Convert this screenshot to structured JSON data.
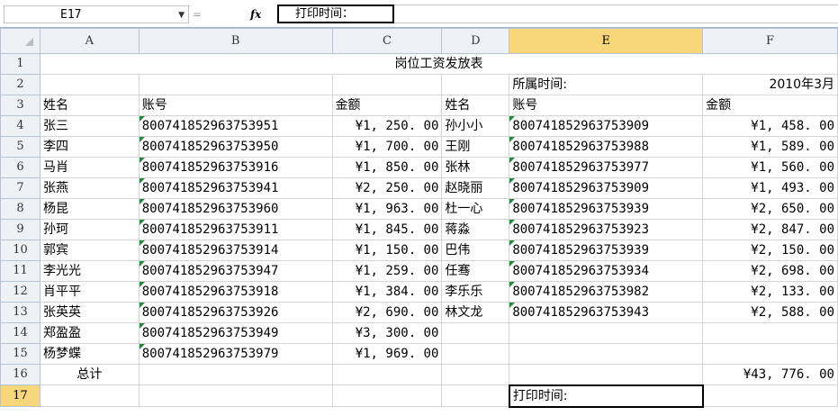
{
  "formula_bar": {
    "name_box": "E17",
    "formula_content": "打印时间：",
    "fx_label": "fx",
    "cancel_symbol": "=",
    "dropdown_symbol": "▼"
  },
  "columns": [
    "A",
    "B",
    "C",
    "D",
    "E",
    "F"
  ],
  "selected_column": "E",
  "row_numbers": [
    "1",
    "2",
    "3",
    "4",
    "5",
    "6",
    "7",
    "8",
    "9",
    "10",
    "11",
    "12",
    "13",
    "14",
    "15",
    "16",
    "17"
  ],
  "selected_row": "17",
  "title": "岗位工资发放表",
  "period_label": "所属时间:",
  "period_value": "2010年3月",
  "headers": {
    "name_1": "姓名",
    "account_1": "账号",
    "amount_1": "金额",
    "name_2": "姓名",
    "account_2": "账号",
    "amount_2": "金额"
  },
  "rows": [
    {
      "n1": "张三",
      "a1": "800741852963753951",
      "m1": "¥1, 250. 00",
      "n2": "孙小小",
      "a2": "800741852963753909",
      "m2": "¥1, 458. 00"
    },
    {
      "n1": "李四",
      "a1": "800741852963753950",
      "m1": "¥1, 700. 00",
      "n2": "王刚",
      "a2": "800741852963753988",
      "m2": "¥1, 589. 00"
    },
    {
      "n1": "马肖",
      "a1": "800741852963753916",
      "m1": "¥1, 850. 00",
      "n2": "张林",
      "a2": "800741852963753977",
      "m2": "¥1, 560. 00"
    },
    {
      "n1": "张燕",
      "a1": "800741852963753941",
      "m1": "¥2, 250. 00",
      "n2": "赵晓丽",
      "a2": "800741852963753909",
      "m2": "¥1, 493. 00"
    },
    {
      "n1": "杨昆",
      "a1": "800741852963753960",
      "m1": "¥1, 963. 00",
      "n2": "杜一心",
      "a2": "800741852963753939",
      "m2": "¥2, 650. 00"
    },
    {
      "n1": "孙珂",
      "a1": "800741852963753911",
      "m1": "¥1, 845. 00",
      "n2": "蒋淼",
      "a2": "800741852963753923",
      "m2": "¥2, 847. 00"
    },
    {
      "n1": "郭宾",
      "a1": "800741852963753914",
      "m1": "¥1, 150. 00",
      "n2": "巴伟",
      "a2": "800741852963753939",
      "m2": "¥2, 150. 00"
    },
    {
      "n1": "李光光",
      "a1": "800741852963753947",
      "m1": "¥1, 259. 00",
      "n2": "任骞",
      "a2": "800741852963753934",
      "m2": "¥2, 698. 00"
    },
    {
      "n1": "肖平平",
      "a1": "800741852963753918",
      "m1": "¥1, 384. 00",
      "n2": "李乐乐",
      "a2": "800741852963753982",
      "m2": "¥2, 133. 00"
    },
    {
      "n1": "张英英",
      "a1": "800741852963753926",
      "m1": "¥2, 690. 00",
      "n2": "林文龙",
      "a2": "800741852963753943",
      "m2": "¥2, 588. 00"
    },
    {
      "n1": "郑盈盈",
      "a1": "800741852963753949",
      "m1": "¥3, 300. 00",
      "n2": "",
      "a2": "",
      "m2": ""
    },
    {
      "n1": "杨梦蝶",
      "a1": "800741852963753979",
      "m1": "¥1, 969. 00",
      "n2": "",
      "a2": "",
      "m2": ""
    }
  ],
  "total_label": "总计",
  "total_value": "¥43, 776. 00",
  "print_time_label": "打印时间:",
  "colors": {
    "header_bg": "#eef1f6",
    "selected_header_bg": "#f7d77a",
    "gridline": "#d4d4d4",
    "error_indicator": "#1e8c3a"
  }
}
